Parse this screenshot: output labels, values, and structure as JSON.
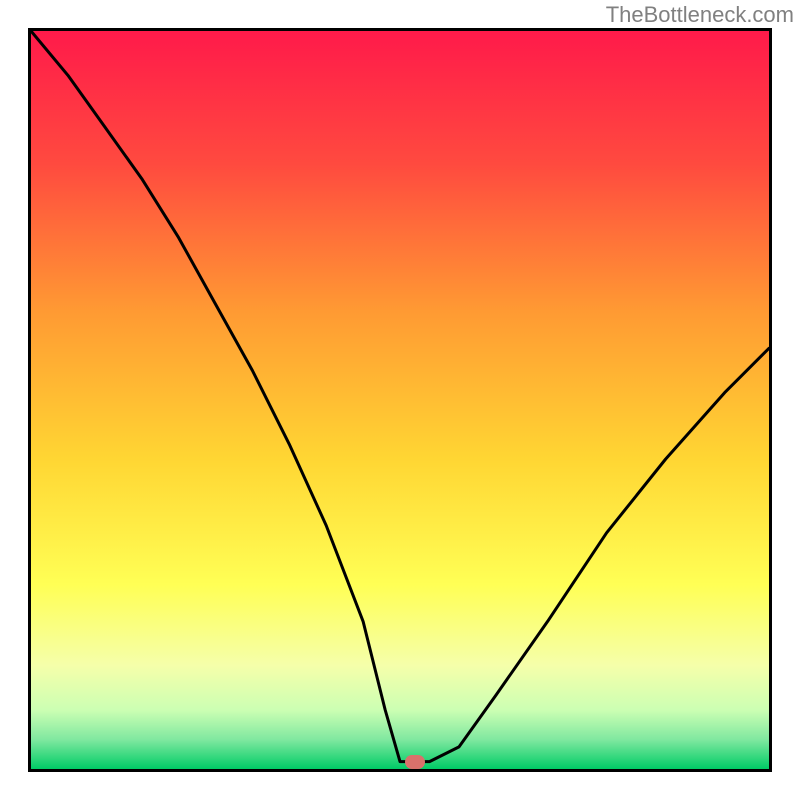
{
  "watermark": "TheBottleneck.com",
  "chart_data": {
    "type": "line",
    "title": "",
    "xlabel": "",
    "ylabel": "",
    "xlim": [
      0,
      100
    ],
    "ylim": [
      0,
      100
    ],
    "grid": false,
    "legend": false,
    "background_gradient": [
      "#ff1a4a",
      "#ff6a3a",
      "#ffcc33",
      "#ffff66",
      "#e6ffcc",
      "#33e08a",
      "#00cc66"
    ],
    "marker": {
      "x": 52,
      "y": 1,
      "color": "#d9716b"
    },
    "series": [
      {
        "name": "bottleneck-curve",
        "x": [
          0,
          5,
          10,
          15,
          20,
          25,
          30,
          35,
          40,
          45,
          48,
          50,
          52,
          54,
          58,
          63,
          70,
          78,
          86,
          94,
          100
        ],
        "values": [
          100,
          94,
          87,
          80,
          72,
          63,
          54,
          44,
          33,
          20,
          8,
          1,
          1,
          1,
          3,
          10,
          20,
          32,
          42,
          51,
          57
        ]
      }
    ]
  }
}
